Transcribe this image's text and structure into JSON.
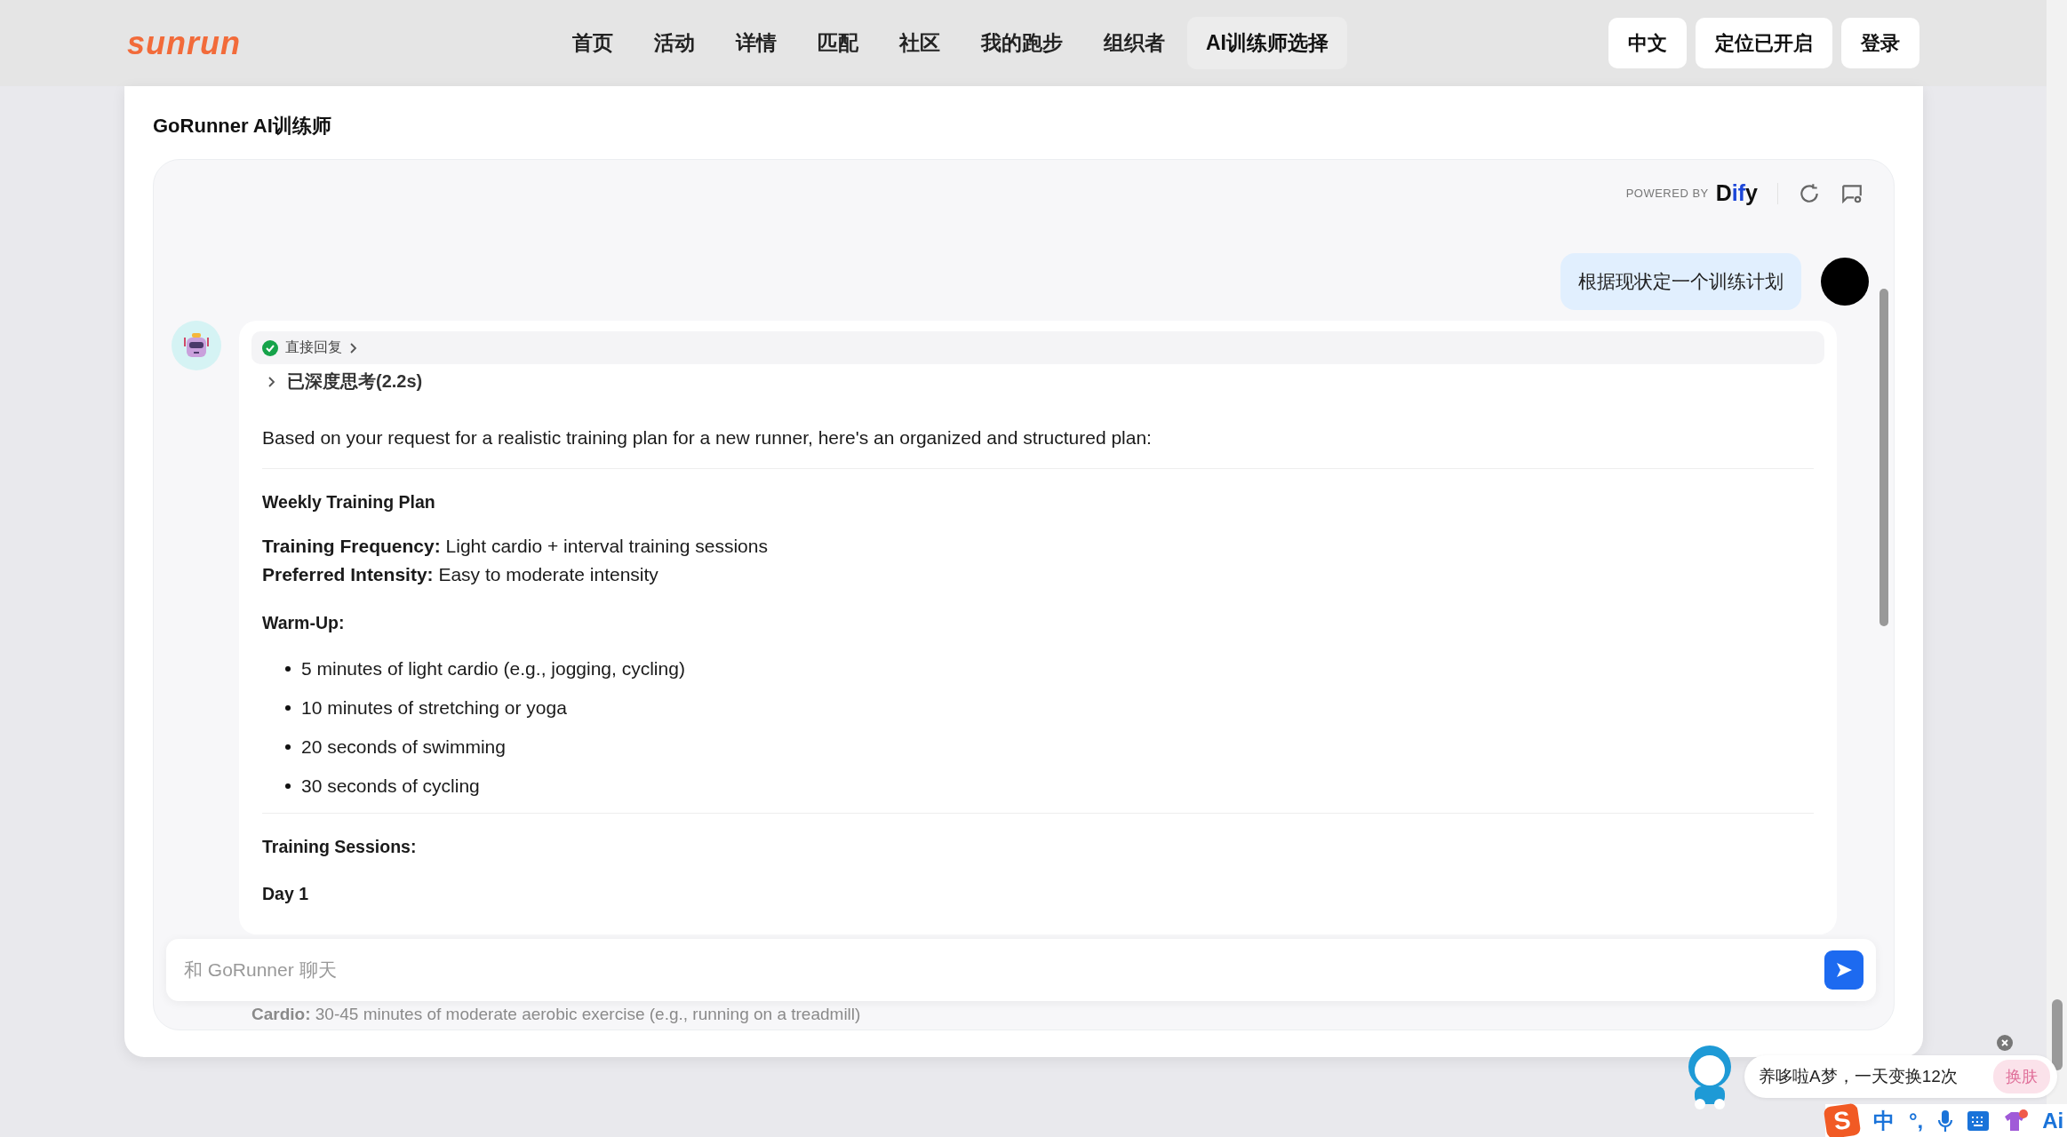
{
  "nav": {
    "logo": "sunrun",
    "links": [
      {
        "label": "首页",
        "selected": false
      },
      {
        "label": "活动",
        "selected": false
      },
      {
        "label": "详情",
        "selected": false
      },
      {
        "label": "匹配",
        "selected": false
      },
      {
        "label": "社区",
        "selected": false
      },
      {
        "label": "我的跑步",
        "selected": false
      },
      {
        "label": "组织者",
        "selected": false
      },
      {
        "label": "AI训练师选择",
        "selected": true
      }
    ],
    "buttons": [
      "中文",
      "定位已开启",
      "登录"
    ]
  },
  "card": {
    "title": "GoRunner AI训练师"
  },
  "chat": {
    "powered_by": "POWERED BY",
    "brand": "Dify",
    "user_message": "根据现状定一个训练计划",
    "bot_message": {
      "status": "直接回复",
      "thinking": "已深度思考(2.2s)",
      "blocks": [
        {
          "kind": "paragraph",
          "text": "Based on your request for a realistic training plan for a new runner, here's an organized and structured plan:"
        },
        {
          "kind": "divider"
        },
        {
          "kind": "heading",
          "text": "Weekly Training Plan"
        },
        {
          "kind": "fields",
          "lines": [
            "**Training Frequency:** Light cardio + interval training sessions",
            "**Preferred Intensity:** Easy to moderate intensity"
          ]
        },
        {
          "kind": "heading",
          "text": "Warm-Up:"
        },
        {
          "kind": "list",
          "items": [
            "5 minutes of light cardio (e.g., jogging, cycling)",
            "10 minutes of stretching or yoga",
            "20 seconds of swimming",
            "30 seconds of cycling"
          ]
        },
        {
          "kind": "divider"
        },
        {
          "kind": "heading",
          "text": "Training Sessions:"
        },
        {
          "kind": "heading",
          "text": "Day 1"
        }
      ]
    },
    "input": {
      "placeholder": "和 GoRunner 聊天"
    },
    "overflow_line": "**Cardio:** 30-45 minutes of moderate aerobic exercise (e.g., running on a treadmill)"
  },
  "ime_popup": {
    "text": "养哆啦A梦，一天变换12次",
    "button": "换肤"
  },
  "ime_bar": {
    "logo": "S",
    "items": [
      "中",
      "°,",
      "Ai"
    ]
  }
}
